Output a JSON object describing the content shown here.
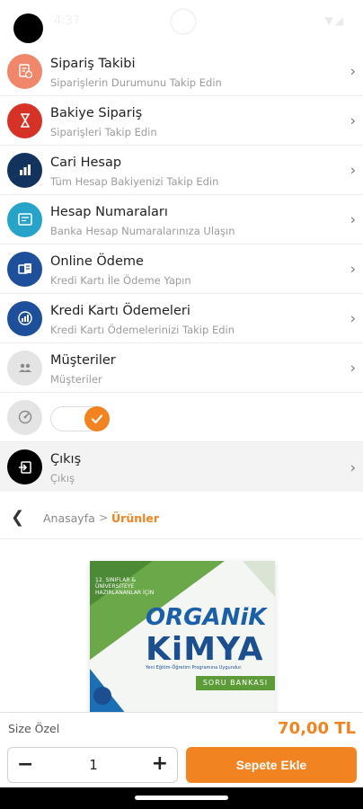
{
  "status_bar": {
    "time": "4:37",
    "icons": "▼◢"
  },
  "menu": [
    {
      "title": "Sipariş Takibi",
      "subtitle": "Siparişlerin Durumunu Takip Edin",
      "color": "#f0876a",
      "icon": "document-clock-icon"
    },
    {
      "title": "Bakiye Sipariş",
      "subtitle": "Siparişleri Takip Edin",
      "color": "#d63326",
      "icon": "hourglass-icon"
    },
    {
      "title": "Cari Hesap",
      "subtitle": "Tüm Hesap Bakiyenizi Takip Edin",
      "color": "#13335f",
      "icon": "bar-chart-icon"
    },
    {
      "title": "Hesap Numaraları",
      "subtitle": "Banka Hesap Numaralarınıza Ulaşın",
      "color": "#27a3c9",
      "icon": "bank-card-icon"
    },
    {
      "title": "Online Ödeme",
      "subtitle": "Kredi Kartı İle Ödeme Yapın",
      "color": "#1d4f9a",
      "icon": "payment-icon"
    },
    {
      "title": "Kredi Kartı Ödemeleri",
      "subtitle": "Kredi Kartı Ödemelerinizi Takip Edin",
      "color": "#1d4f9a",
      "icon": "line-chart-icon"
    },
    {
      "title": "Müşteriler",
      "subtitle": "Müşteriler",
      "color": "#e4e4e4",
      "icon": "users-icon"
    }
  ],
  "toggle": {
    "checked": true,
    "icon": "gauge-icon",
    "color": "#f18421"
  },
  "logout": {
    "title": "Çıkış",
    "subtitle": "Çıkış",
    "icon": "logout-icon"
  },
  "breadcrumb": {
    "home": "Anasayfa",
    "separator": ">",
    "current": "Ürünler"
  },
  "product": {
    "book_top": "12. SINIFLAR & ÜNİVERSİTEYE HAZIRLANANLAR İÇİN",
    "book_brand": "ORGANiK",
    "book_title": "KiMYA",
    "book_small": "Yeni Eğitim-Öğretim Programına Uygundur.",
    "book_badge": "SORU BANKASI"
  },
  "cart": {
    "special_label": "Size Özel",
    "price": "70,00 TL",
    "quantity": "1",
    "minus": "−",
    "plus": "+",
    "add_button": "Sepete Ekle"
  }
}
